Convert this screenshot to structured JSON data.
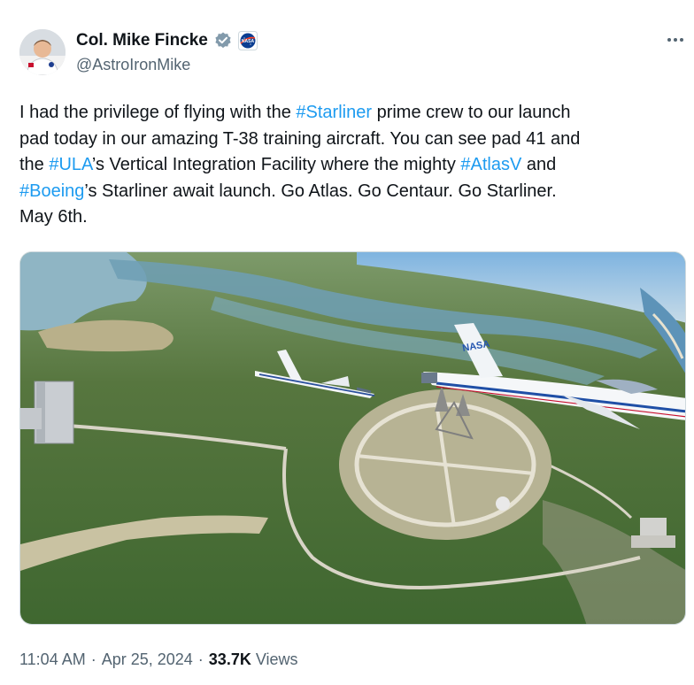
{
  "author": {
    "name": "Col. Mike Fincke",
    "handle": "@AstroIronMike",
    "verified": true,
    "affiliation_badge": "nasa-logo-icon",
    "avatar": "astronaut-avatar"
  },
  "tweet": {
    "lines": [
      [
        {
          "t": "I had the privilege of flying with the "
        },
        {
          "t": "#Starliner",
          "tag": true
        },
        {
          "t": " prime crew to our launch"
        }
      ],
      [
        {
          "t": "pad today in our amazing T-38 training aircraft.  You can see pad 41 and"
        }
      ],
      [
        {
          "t": "the "
        },
        {
          "t": "#ULA",
          "tag": true
        },
        {
          "t": "’s Vertical Integration Facility where the mighty "
        },
        {
          "t": "#AtlasV",
          "tag": true
        },
        {
          "t": "  and"
        }
      ],
      [
        {
          "t": "#Boeing",
          "tag": true
        },
        {
          "t": "’s Starliner await launch.   Go Atlas.  Go Centaur.  Go Starliner."
        }
      ],
      [
        {
          "t": "May 6th."
        }
      ]
    ],
    "image": "aerial-photo-t38-jets-over-launch-pad-41"
  },
  "footer": {
    "time": "11:04 AM",
    "date": "Apr 25, 2024",
    "views_count": "33.7K",
    "views_label": "Views"
  },
  "colors": {
    "text": "#0f1419",
    "secondary": "#536471",
    "link": "#1d9bf0"
  },
  "icons": [
    "verified-badge-icon",
    "nasa-logo-icon",
    "more-options-icon"
  ]
}
